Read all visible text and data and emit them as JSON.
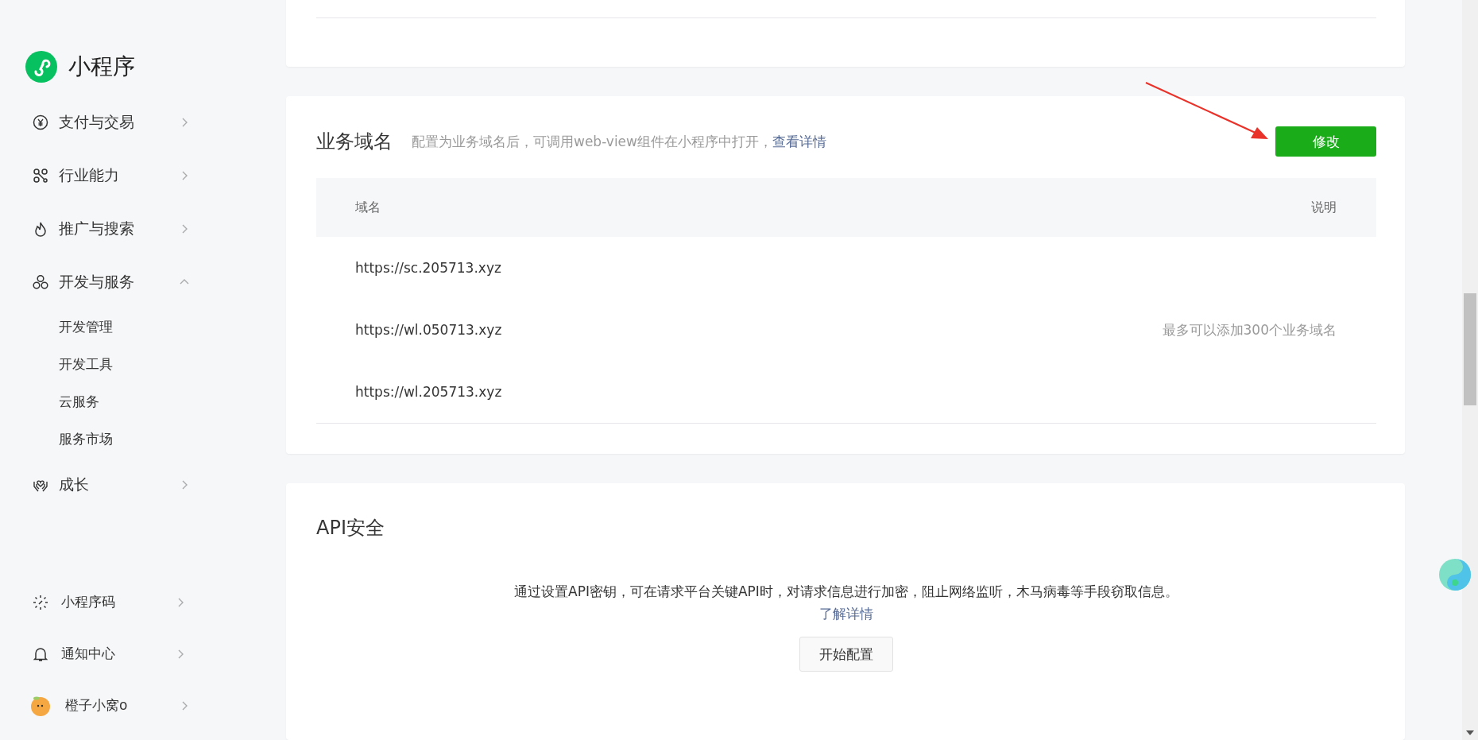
{
  "sidebar": {
    "logo": {
      "title": "小程序"
    },
    "groups": [
      {
        "label": "支付与交易",
        "expanded": false
      },
      {
        "label": "行业能力",
        "expanded": false
      },
      {
        "label": "推广与搜索",
        "expanded": false
      },
      {
        "label": "开发与服务",
        "expanded": true,
        "children": [
          {
            "label": "开发管理"
          },
          {
            "label": "开发工具"
          },
          {
            "label": "云服务"
          },
          {
            "label": "服务市场"
          }
        ]
      },
      {
        "label": "成长",
        "expanded": false
      }
    ],
    "bottom_items": [
      {
        "label": "小程序码",
        "kind": "link"
      },
      {
        "label": "通知中心",
        "kind": "link"
      },
      {
        "label": "橙子小窝o",
        "kind": "account"
      }
    ]
  },
  "domain_card": {
    "title": "业务域名",
    "description": "配置为业务域名后，可调用web-view组件在小程序中打开，",
    "link": "查看详情",
    "button": "修改",
    "columns": [
      "域名",
      "说明"
    ],
    "rows": [
      {
        "domain": "https://sc.205713.xyz"
      },
      {
        "domain": "https://wl.050713.xyz",
        "note": "最多可以添加300个业务域名"
      },
      {
        "domain": "https://wl.205713.xyz"
      }
    ]
  },
  "api_card": {
    "title": "API安全",
    "description": "通过设置API密钥，可在请求平台关键API时，对请求信息进行加密，阻止网络监听，木马病毒等手段窃取信息。",
    "link": "了解详情",
    "button": "开始配置"
  }
}
